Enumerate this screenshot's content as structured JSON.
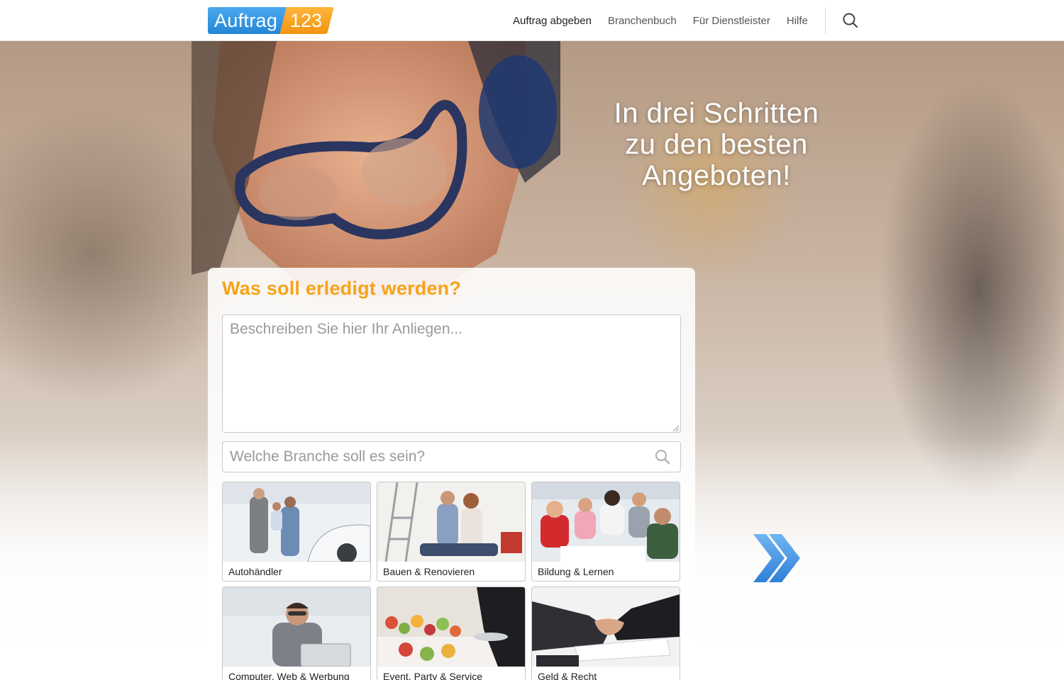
{
  "header": {
    "logo": {
      "left": "Auftrag",
      "right": "123"
    },
    "nav": [
      {
        "label": "Auftrag abgeben",
        "active": true
      },
      {
        "label": "Branchenbuch",
        "active": false
      },
      {
        "label": "Für Dienstleister",
        "active": false
      },
      {
        "label": "Hilfe",
        "active": false
      }
    ],
    "search_icon": "search-icon"
  },
  "hero": {
    "headline": [
      "In drei Schritten",
      "zu den besten",
      "Angeboten!"
    ]
  },
  "form": {
    "title": "Was soll erledigt werden?",
    "description_placeholder": "Beschreiben Sie hier Ihr Anliegen...",
    "description_value": "",
    "branche_placeholder": "Welche Branche soll es sein?",
    "branche_value": ""
  },
  "categories": [
    {
      "label": "Autohändler"
    },
    {
      "label": "Bauen & Renovieren"
    },
    {
      "label": "Bildung & Lernen"
    },
    {
      "label": "Computer, Web & Werbung"
    },
    {
      "label": "Event, Party & Service"
    },
    {
      "label": "Geld & Recht"
    }
  ],
  "colors": {
    "accent_orange": "#f6a318",
    "logo_blue": "#2587d6",
    "logo_orange": "#f39511",
    "arrow_blue": "#3a8fe0"
  },
  "icons": {
    "next_arrow": "double-chevron-right-icon"
  }
}
